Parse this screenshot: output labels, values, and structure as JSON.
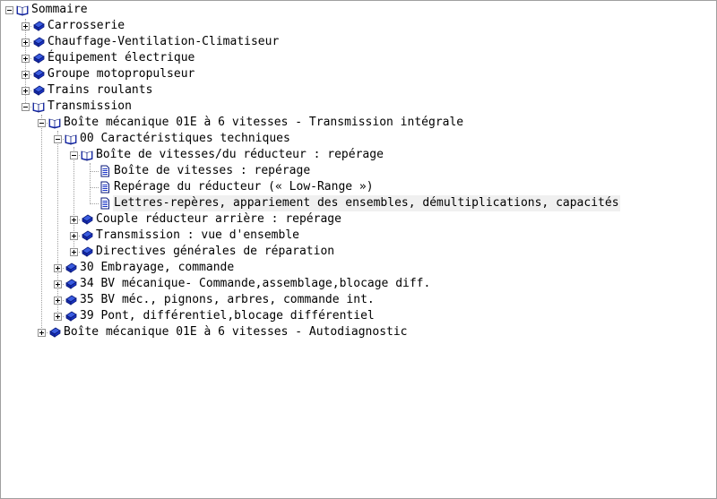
{
  "tree": {
    "root": {
      "label": "Sommaire",
      "icon": "book-open-icon"
    },
    "carrosserie": {
      "label": "Carrosserie",
      "icon": "book-closed-icon"
    },
    "chauffage": {
      "label": "Chauffage-Ventilation-Climatiseur",
      "icon": "book-closed-icon"
    },
    "equipement": {
      "label": "Équipement électrique",
      "icon": "book-closed-icon"
    },
    "groupe": {
      "label": "Groupe motopropulseur",
      "icon": "book-closed-icon"
    },
    "trains": {
      "label": "Trains roulants",
      "icon": "book-closed-icon"
    },
    "transmission": {
      "label": "Transmission",
      "icon": "book-open-icon"
    },
    "boite_integrale": {
      "label": "Boîte mécanique 01E à 6 vitesses - Transmission intégrale",
      "icon": "book-open-icon"
    },
    "caracteristiques": {
      "label": "00 Caractéristiques techniques",
      "icon": "book-open-icon"
    },
    "boite_reducteur": {
      "label": "Boîte de vitesses/du réducteur : repérage",
      "icon": "book-open-icon"
    },
    "doc_boite": {
      "label": "Boîte de vitesses : repérage",
      "icon": "document-icon"
    },
    "doc_reducteur": {
      "label": "Repérage du réducteur (« Low-Range »)",
      "icon": "document-icon"
    },
    "doc_lettres": {
      "label": "Lettres-repères, appariement des ensembles, démultiplications, capacités",
      "icon": "document-icon"
    },
    "couple": {
      "label": "Couple réducteur arrière : repérage",
      "icon": "book-closed-icon"
    },
    "transmission_vue": {
      "label": "Transmission : vue d'ensemble",
      "icon": "book-closed-icon"
    },
    "directives": {
      "label": "Directives générales de réparation",
      "icon": "book-closed-icon"
    },
    "embrayage": {
      "label": "30 Embrayage, commande",
      "icon": "book-closed-icon"
    },
    "bv34": {
      "label": "34 BV mécanique- Commande,assemblage,blocage diff.",
      "icon": "book-closed-icon"
    },
    "bv35": {
      "label": "35 BV méc., pignons, arbres, commande int.",
      "icon": "book-closed-icon"
    },
    "pont39": {
      "label": "39 Pont, différentiel,blocage différentiel",
      "icon": "book-closed-icon"
    },
    "autodiag": {
      "label": "Boîte mécanique 01E à 6 vitesses - Autodiagnostic",
      "icon": "book-closed-icon"
    }
  },
  "colors": {
    "book_blue": "#1a34c8",
    "selection": "#f0f0f0",
    "tree_lines": "#a0a0a0"
  }
}
